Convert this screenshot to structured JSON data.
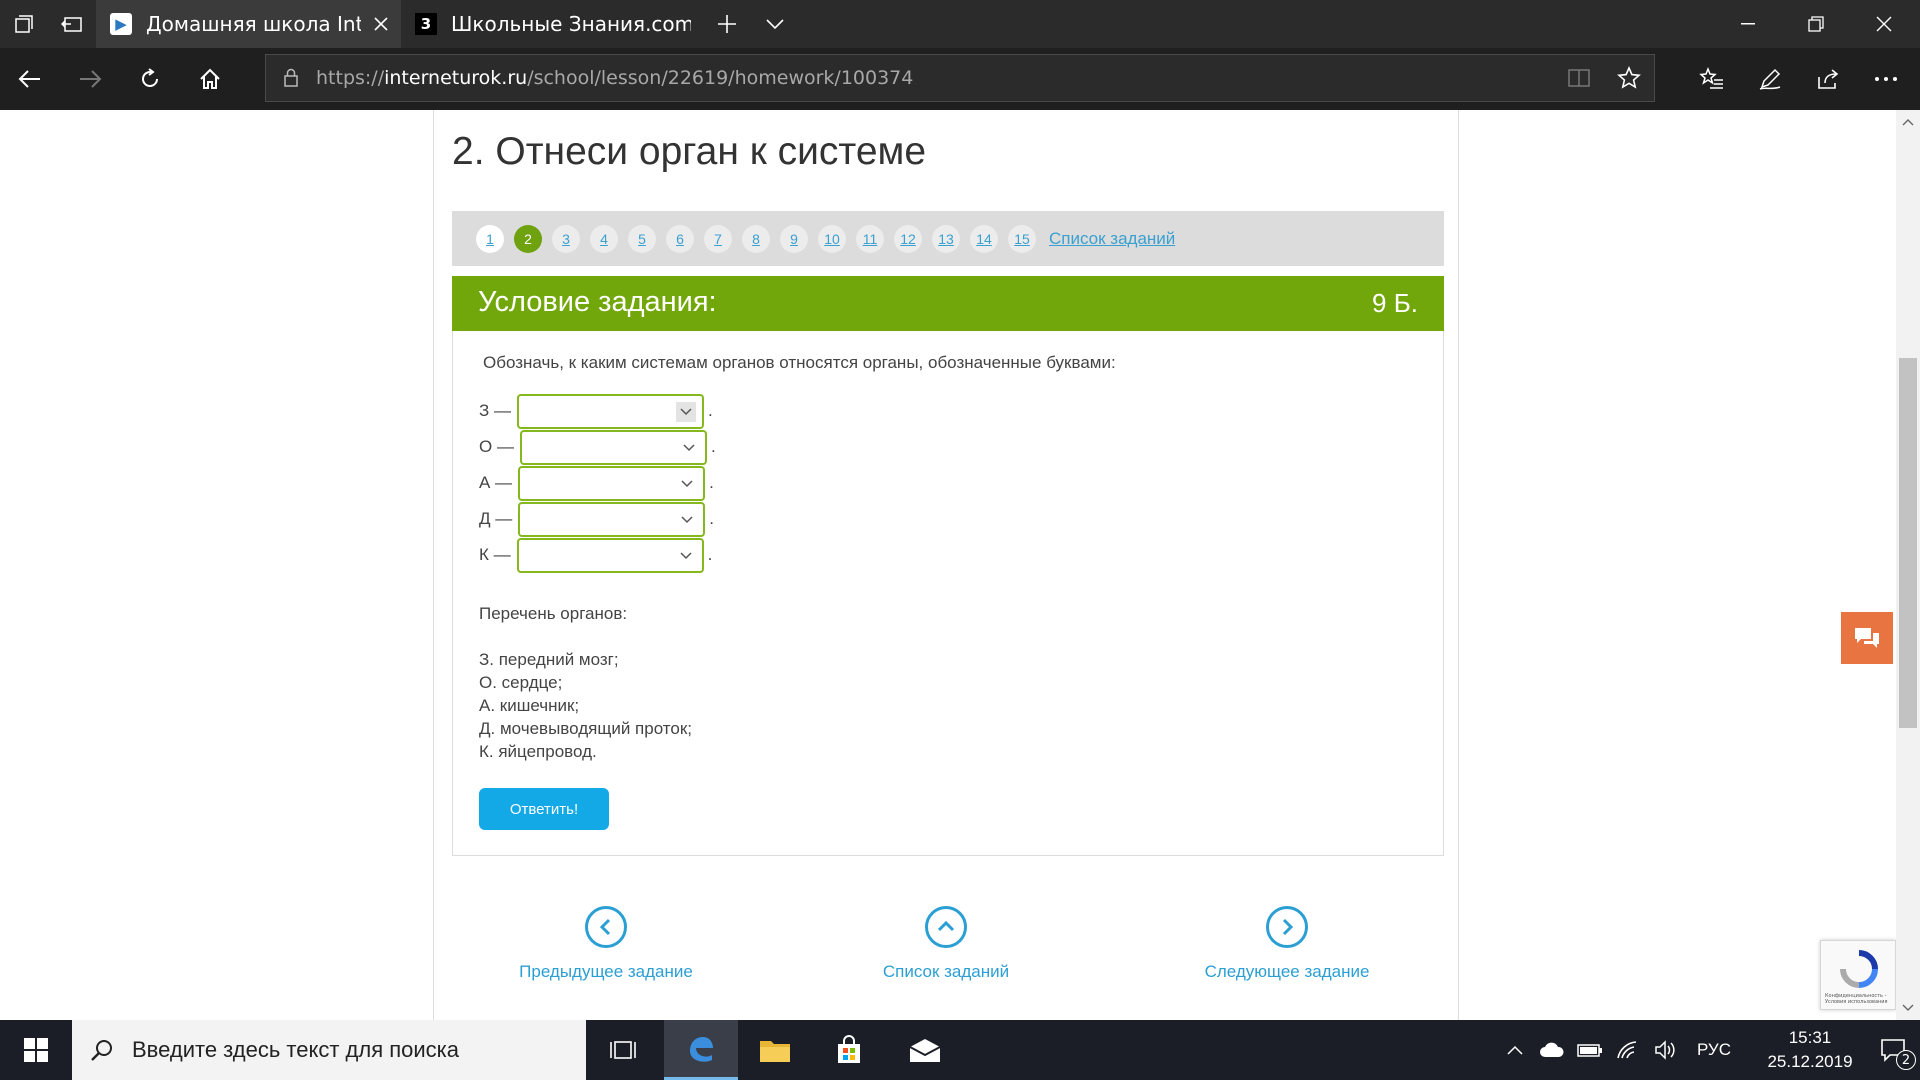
{
  "browser": {
    "tabs": [
      {
        "title": "Домашняя школа Inter",
        "favicon_label": "▶",
        "active": true
      },
      {
        "title": "Школьные Знания.com - Р",
        "favicon_label": "3",
        "active": false
      }
    ],
    "url_prefix": "https://",
    "url_host": "interneturok.ru",
    "url_path": "/school/lesson/22619/homework/100374"
  },
  "page": {
    "heading": "2. Отнеси орган к системе",
    "pager": {
      "numbers": [
        "1",
        "2",
        "3",
        "4",
        "5",
        "6",
        "7",
        "8",
        "9",
        "10",
        "11",
        "12",
        "13",
        "14",
        "15"
      ],
      "current": "2",
      "list_link": "Список заданий"
    },
    "task": {
      "header_label": "Условие задания:",
      "points": "9 Б.",
      "instruction": "Обозначь, к каким системам органов относятся органы, обозначенные буквами:",
      "rows": [
        {
          "label": "З —",
          "value": ""
        },
        {
          "label": "О —",
          "value": ""
        },
        {
          "label": "А —",
          "value": ""
        },
        {
          "label": "Д —",
          "value": ""
        },
        {
          "label": "К —",
          "value": ""
        }
      ],
      "row_suffix": ".",
      "organ_list_title": "Перечень органов:",
      "organs": [
        "З. передний мозг;",
        "О. сердце;",
        "А. кишечник;",
        "Д. мочевыводящий проток;",
        "К. яйцепровод."
      ],
      "answer_button": "Ответить!"
    },
    "bottom_nav": {
      "prev": "Предыдущее задание",
      "list": "Список заданий",
      "next": "Следующее задание"
    },
    "recaptcha_text": "Конфиденциальность - Условия использования"
  },
  "taskbar": {
    "search_placeholder": "Введите здесь текст для поиска",
    "language": "РУС",
    "time": "15:31",
    "date": "25.12.2019",
    "notification_count": "2"
  },
  "colors": {
    "accent_green": "#71a70a",
    "link_blue": "#2b9fd3",
    "button_blue": "#13a8e6",
    "chat_orange": "#e87442"
  }
}
